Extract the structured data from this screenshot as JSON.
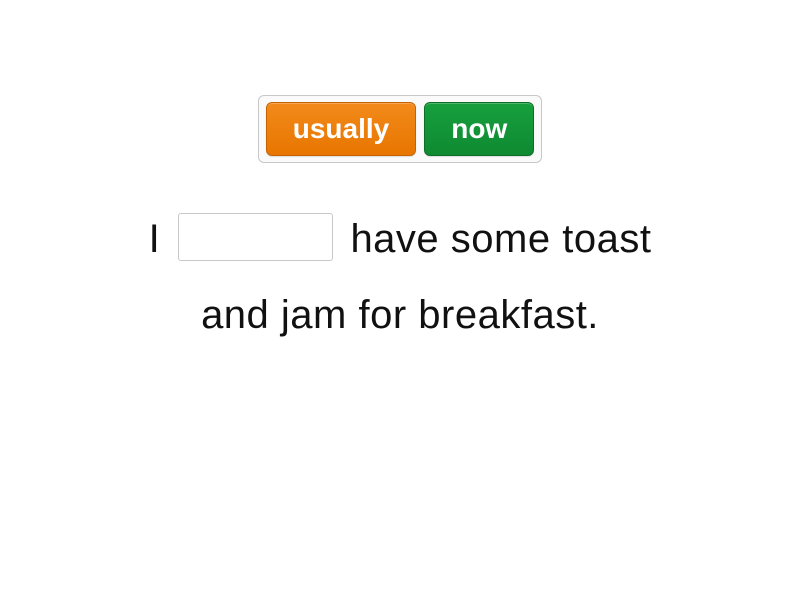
{
  "options": [
    {
      "label": "usually",
      "color": "orange"
    },
    {
      "label": "now",
      "color": "green"
    }
  ],
  "sentence": {
    "before": "I",
    "after_line1": " have some toast",
    "line2": "and jam for breakfast."
  }
}
